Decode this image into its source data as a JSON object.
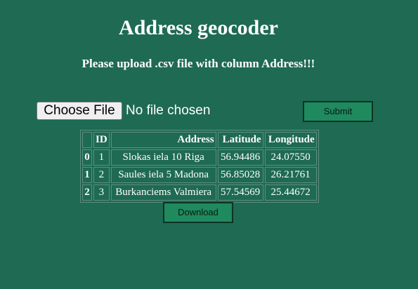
{
  "header": {
    "title": "Address geocoder",
    "instruction": "Please upload .csv file with column Address!!!"
  },
  "upload": {
    "choose_label": "Choose File",
    "status": "No file chosen",
    "submit_label": "Submit"
  },
  "table": {
    "columns": [
      "",
      "ID",
      "Address",
      "Latitude",
      "Longitude"
    ],
    "rows": [
      {
        "index": "0",
        "id": "1",
        "address": "Slokas iela 10 Riga",
        "latitude": "56.94486",
        "longitude": "24.07550"
      },
      {
        "index": "1",
        "id": "2",
        "address": "Saules iela 5 Madona",
        "latitude": "56.85028",
        "longitude": "26.21761"
      },
      {
        "index": "2",
        "id": "3",
        "address": "Burkanciems Valmiera",
        "latitude": "57.54569",
        "longitude": "25.44672"
      }
    ]
  },
  "download": {
    "label": "Download"
  },
  "colors": {
    "background": "#1e6a52",
    "button": "#1f8a5e"
  }
}
